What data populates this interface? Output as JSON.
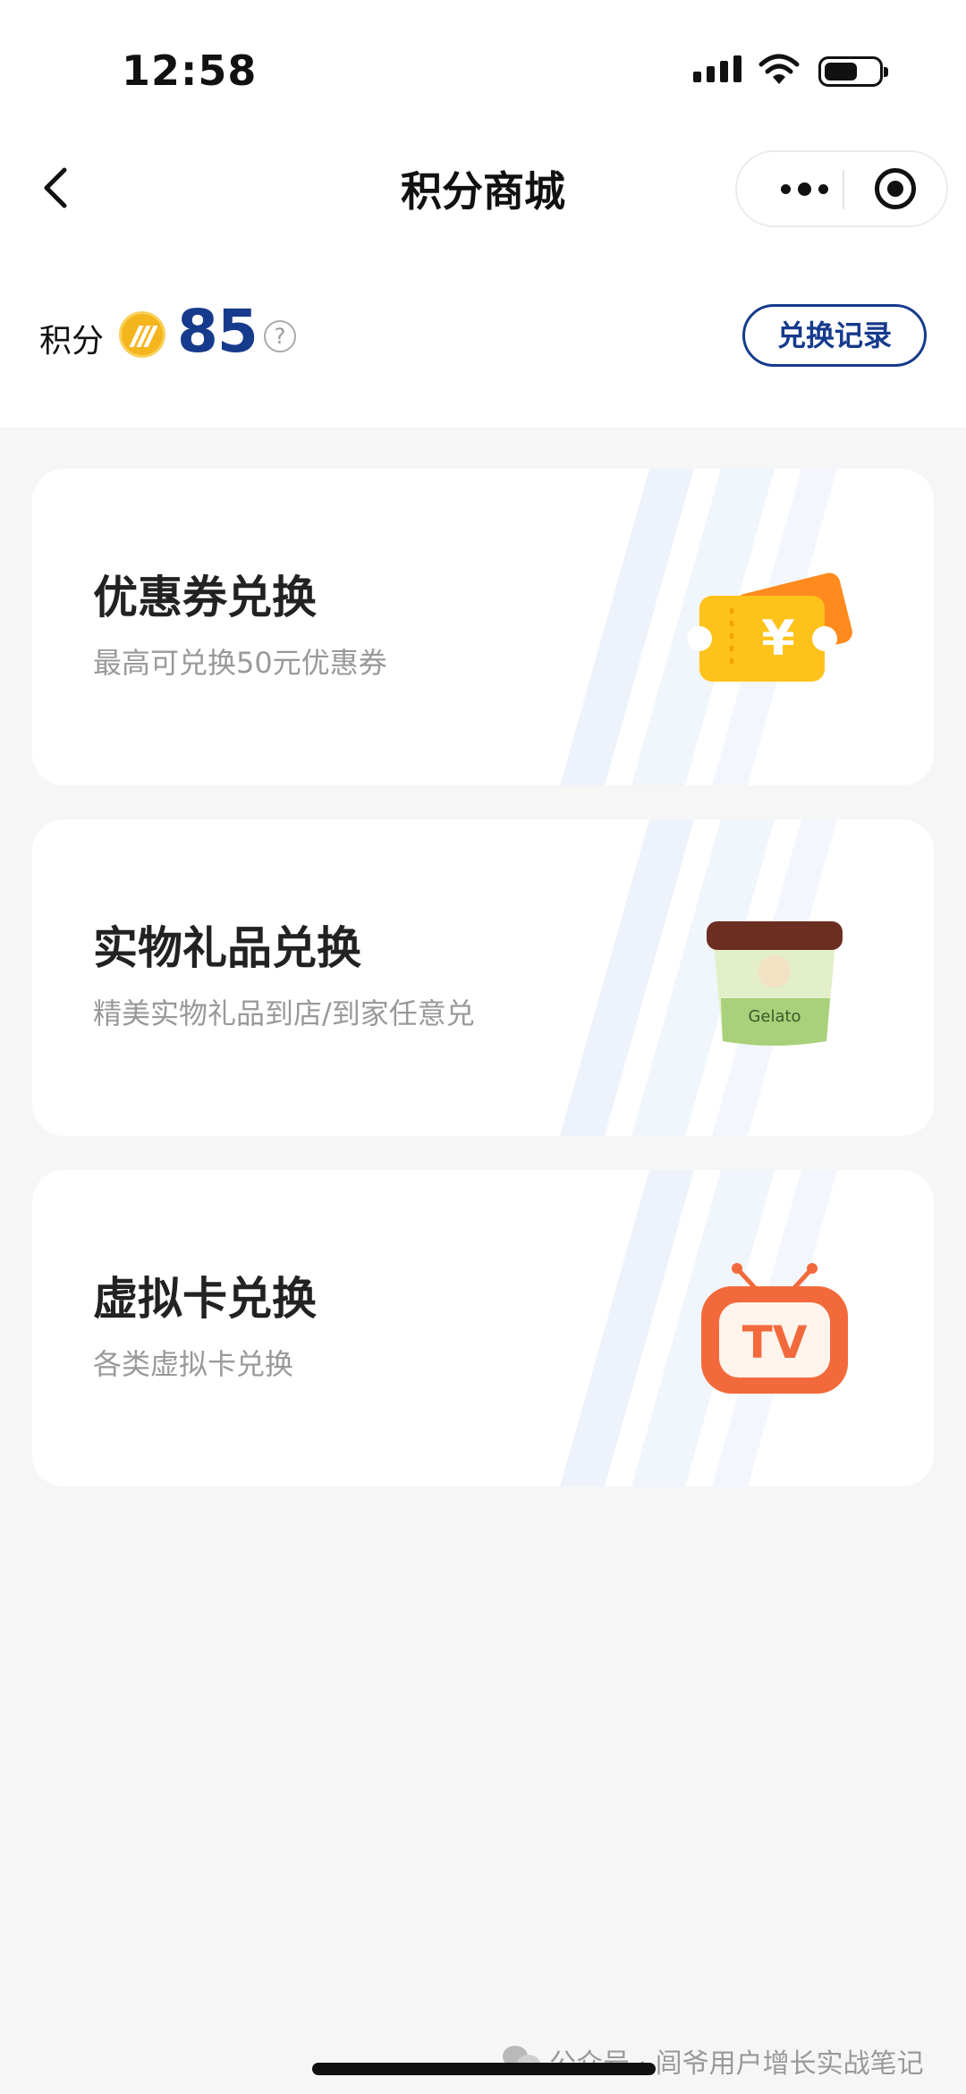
{
  "status_bar": {
    "time": "12:58",
    "icons": [
      "signal-icon",
      "wifi-icon",
      "battery-icon"
    ]
  },
  "navbar": {
    "title": "积分商城",
    "back_icon": "chevron-left-icon",
    "more_icon": "more-dots-icon",
    "close_icon": "target-circle-icon"
  },
  "points": {
    "label": "积分",
    "value": "85",
    "coin_icon": "points-coin-icon",
    "help_symbol": "?",
    "record_button": "兑换记录"
  },
  "cards": [
    {
      "title": "优惠券兑换",
      "subtitle": "最高可兑换50元优惠券",
      "icon": "coupon-ticket-icon",
      "icon_text": "¥"
    },
    {
      "title": "实物礼品兑换",
      "subtitle": "精美实物礼品到店/到家任意兑",
      "icon": "ice-cream-cup-icon",
      "icon_text": "Gelato"
    },
    {
      "title": "虚拟卡兑换",
      "subtitle": "各类虚拟卡兑换",
      "icon": "tv-icon",
      "icon_text": "TV"
    }
  ],
  "watermark": {
    "text": "公众号 · 闾爷用户增长实战笔记",
    "icon": "wechat-icon"
  },
  "colors": {
    "brand_blue": "#163a8c",
    "coin_yellow": "#f5b51d",
    "background": "#f6f6f7",
    "tv_orange": "#f26a3c",
    "coupon_yellow": "#ffc21a"
  }
}
